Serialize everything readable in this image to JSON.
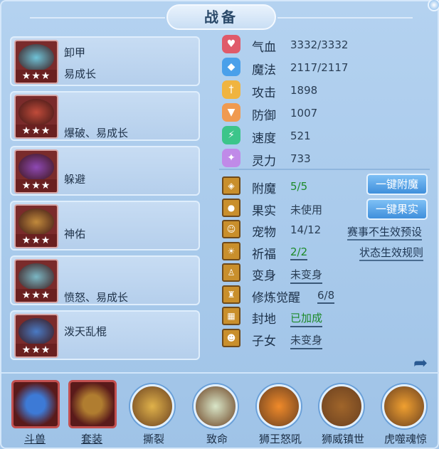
{
  "title": "战备",
  "equipment": [
    {
      "label": "卸甲",
      "label2": "易成长",
      "stars": "★★★",
      "art": "#6fc3d8"
    },
    {
      "label": "",
      "label2": "爆破、易成长",
      "stars": "★★★",
      "art": "#c04b3a"
    },
    {
      "label": "",
      "label2": "躲避",
      "stars": "★★★",
      "art": "#8e49b4"
    },
    {
      "label": "",
      "label2": "神佑",
      "stars": "★★★",
      "art": "#c18a3c"
    },
    {
      "label": "",
      "label2": "愤怒、易成长",
      "stars": "★★★",
      "art": "#7bb7c4"
    },
    {
      "label": "泼天乱棍",
      "label2": "",
      "stars": "★★★",
      "art": "#4a7ac4"
    }
  ],
  "stats": [
    {
      "name": "气血",
      "value": "3332/3332",
      "icon": "heart-icon",
      "color": "#e05a6a",
      "glyph": "♥"
    },
    {
      "name": "魔法",
      "value": "2117/2117",
      "icon": "mana-shield-icon",
      "color": "#4aa0ea",
      "glyph": "◆"
    },
    {
      "name": "攻击",
      "value": "1898",
      "icon": "sword-icon",
      "color": "#f0b440",
      "glyph": "†"
    },
    {
      "name": "防御",
      "value": "1007",
      "icon": "armor-icon",
      "color": "#f09a50",
      "glyph": "▼"
    },
    {
      "name": "速度",
      "value": "521",
      "icon": "speed-icon",
      "color": "#3cc58a",
      "glyph": "⚡"
    },
    {
      "name": "灵力",
      "value": "733",
      "icon": "spirit-icon",
      "color": "#c08ae8",
      "glyph": "✦"
    }
  ],
  "features": [
    {
      "name": "附魔",
      "value": "5/5",
      "green": true,
      "underline": false,
      "icon": "enchant-icon",
      "glyph": "◈"
    },
    {
      "name": "果实",
      "value": "未使用",
      "green": false,
      "underline": false,
      "icon": "fruit-icon",
      "glyph": "●"
    },
    {
      "name": "宠物",
      "value": "14/12",
      "green": false,
      "underline": false,
      "icon": "pet-icon",
      "glyph": "☺"
    },
    {
      "name": "祈福",
      "value": "2/2",
      "green": true,
      "underline": true,
      "icon": "blessing-icon",
      "glyph": "☀"
    },
    {
      "name": "变身",
      "value": "未变身",
      "green": false,
      "underline": true,
      "icon": "transform-icon",
      "glyph": "♙"
    },
    {
      "name": "修炼觉醒",
      "value": "6/8",
      "green": false,
      "underline": true,
      "icon": "cultivation-icon",
      "glyph": "♜"
    },
    {
      "name": "封地",
      "value": "已加成",
      "green": true,
      "underline": true,
      "icon": "fief-icon",
      "glyph": "▦"
    },
    {
      "name": "子女",
      "value": "未变身",
      "green": false,
      "underline": true,
      "icon": "child-icon",
      "glyph": "☻"
    }
  ],
  "buttons": {
    "enchant": "一键附魔",
    "fruit": "一键果实"
  },
  "links": {
    "tournament": "赛事不生效预设",
    "rules": "状态生效规则"
  },
  "skills": [
    {
      "label": "斗兽",
      "shape": "square",
      "color": "#3d7ad6"
    },
    {
      "label": "套装",
      "shape": "square",
      "color": "#b07d30"
    },
    {
      "label": "撕裂",
      "shape": "circle",
      "color": "#e0b24a"
    },
    {
      "label": "致命",
      "shape": "circle",
      "color": "#d9e6c8"
    },
    {
      "label": "狮王怒吼",
      "shape": "circle",
      "color": "#f08a2a"
    },
    {
      "label": "狮威镇世",
      "shape": "circle",
      "color": "#a0652a"
    },
    {
      "label": "虎噬魂惊",
      "shape": "circle",
      "color": "#f0a030"
    }
  ]
}
